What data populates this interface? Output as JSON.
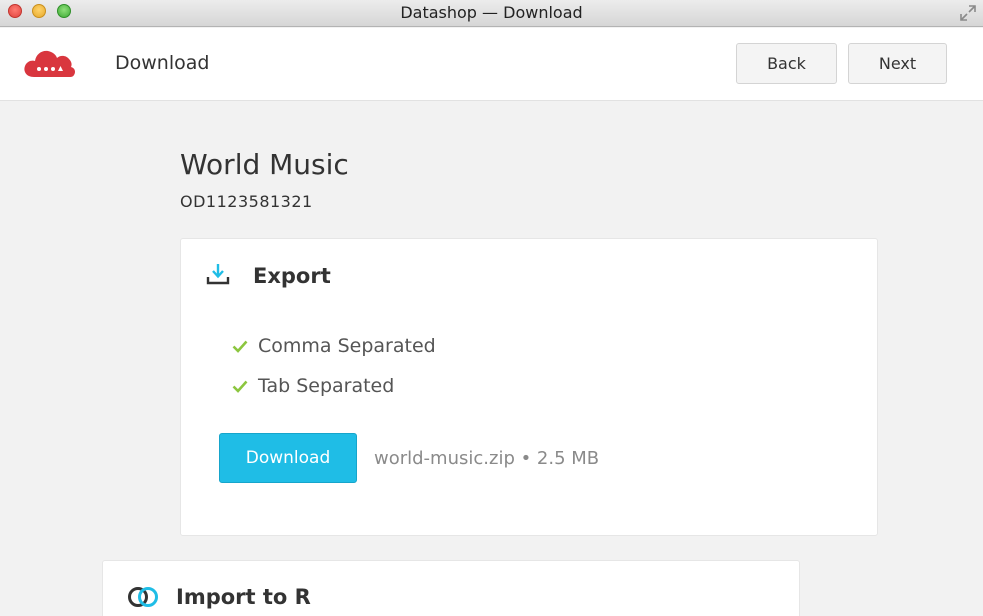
{
  "window": {
    "title": "Datashop — Download"
  },
  "header": {
    "title": "Download",
    "back_label": "Back",
    "next_label": "Next",
    "brand_color": "#d9363e"
  },
  "dataset": {
    "name": "World Music",
    "id": "OD1123581321"
  },
  "export": {
    "title": "Export",
    "formats": [
      {
        "label": "Comma Separated",
        "selected": true
      },
      {
        "label": "Tab Separated",
        "selected": true
      }
    ],
    "download_label": "Download",
    "file_info": "world-music.zip • 2.5 MB",
    "accent_color": "#1fbde6",
    "check_color": "#8cc63f"
  },
  "import": {
    "title": "Import to R"
  }
}
